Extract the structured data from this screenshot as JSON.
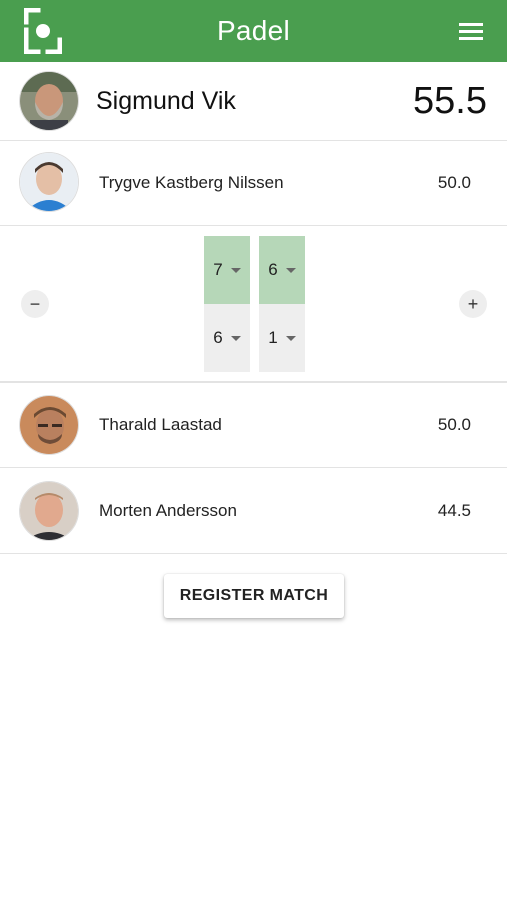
{
  "app": {
    "title": "Padel",
    "accent_color": "#4a9e4f",
    "menu_icon": "hamburger-icon",
    "logo_icon": "app-logo-icon"
  },
  "players": [
    {
      "name": "Sigmund Vik",
      "rating": "55.5",
      "avatar": "avatar-photo"
    },
    {
      "name": "Trygve Kastberg Nilssen",
      "rating": "50.0",
      "avatar": "avatar-photo"
    },
    {
      "name": "Tharald Laastad",
      "rating": "50.0",
      "avatar": "avatar-photo"
    },
    {
      "name": "Morten Andersson",
      "rating": "44.5",
      "avatar": "avatar-photo"
    }
  ],
  "score": {
    "minus_label": "−",
    "plus_label": "+",
    "sets": [
      {
        "team1": "7",
        "team2": "6"
      },
      {
        "team1": "6",
        "team2": "1"
      }
    ],
    "win_color": "#b6d7b8",
    "loss_color": "#eeeeee"
  },
  "actions": {
    "register_label": "REGISTER MATCH"
  }
}
